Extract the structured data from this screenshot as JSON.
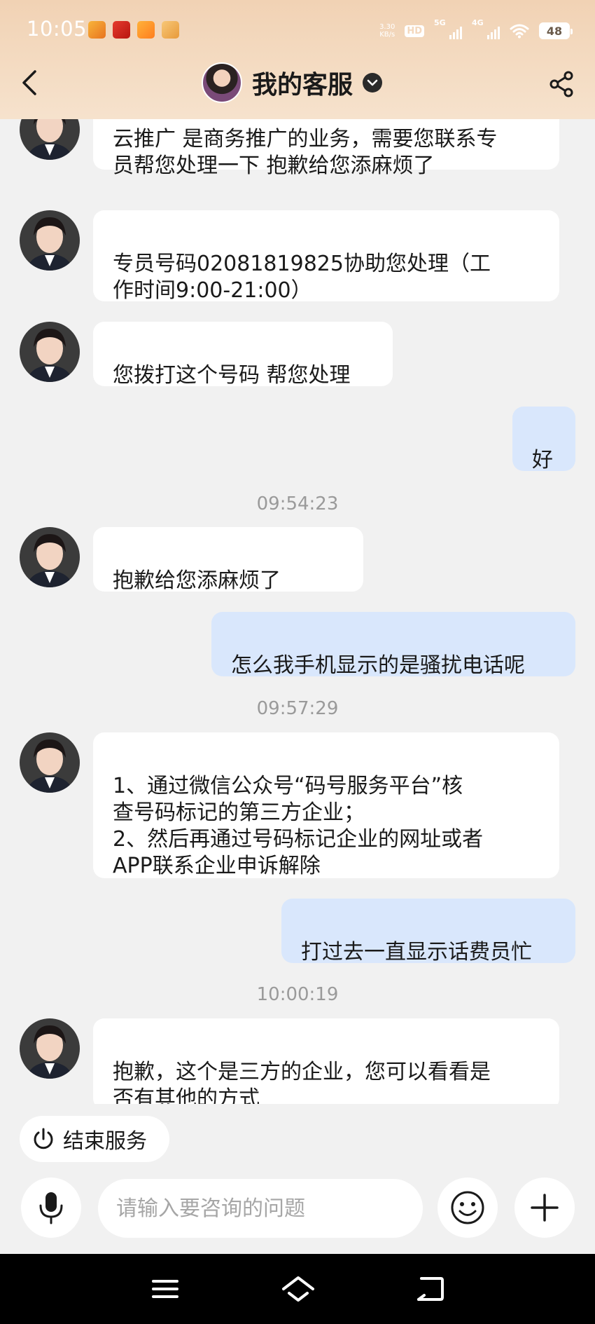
{
  "status_bar": {
    "time": "10:05",
    "net_speed_value": "3.30",
    "net_speed_unit": "KB/s",
    "hd_label": "HD",
    "signal_1": "5G",
    "signal_2": "4G",
    "battery": "48",
    "app_icons": [
      "app-icon-1",
      "app-icon-2",
      "app-icon-3",
      "app-icon-4"
    ]
  },
  "header": {
    "title": "我的客服",
    "back_icon": "back-arrow-icon",
    "share_icon": "share-icon",
    "dropdown_icon": "chevron-down-icon"
  },
  "messages": [
    {
      "from": "agent",
      "text": "云推广 是商务推广的业务，需要您联系专\n员帮您处理一下 抱歉给您添麻烦了"
    },
    {
      "from": "agent",
      "text": "专员号码02081819825协助您处理（工\n作时间9:00-21:00）"
    },
    {
      "from": "agent",
      "text": "您拨打这个号码 帮您处理"
    },
    {
      "from": "user",
      "text": "好"
    },
    {
      "from": "system",
      "text": "09:54:23"
    },
    {
      "from": "agent",
      "text": "抱歉给您添麻烦了"
    },
    {
      "from": "user",
      "text": "怎么我手机显示的是骚扰电话呢"
    },
    {
      "from": "system",
      "text": "09:57:29"
    },
    {
      "from": "agent",
      "text": "1、通过微信公众号“码号服务平台”核\n查号码标记的第三方企业；\n2、然后再通过号码标记企业的网址或者\nAPP联系企业申诉解除"
    },
    {
      "from": "user",
      "text": "打过去一直显示话费员忙"
    },
    {
      "from": "system",
      "text": "10:00:19"
    },
    {
      "from": "agent",
      "text": "抱歉，这个是三方的企业，您可以看看是\n否有其他的方式"
    }
  ],
  "controls": {
    "end_service_label": "结束服务",
    "input_placeholder": "请输入要咨询的问题",
    "mic_icon": "microphone-icon",
    "emoji_icon": "emoji-icon",
    "plus_icon": "plus-icon",
    "power_icon": "power-icon"
  },
  "nav_bar": {
    "menu_icon": "menu-icon",
    "home_icon": "home-icon",
    "back_icon": "back-icon"
  },
  "colors": {
    "header_gradient_top": "#f1d2b4",
    "agent_bubble": "#ffffff",
    "user_bubble": "#d9e7fc",
    "background": "#f1f1f1",
    "timestamp": "#9a9a9a"
  }
}
